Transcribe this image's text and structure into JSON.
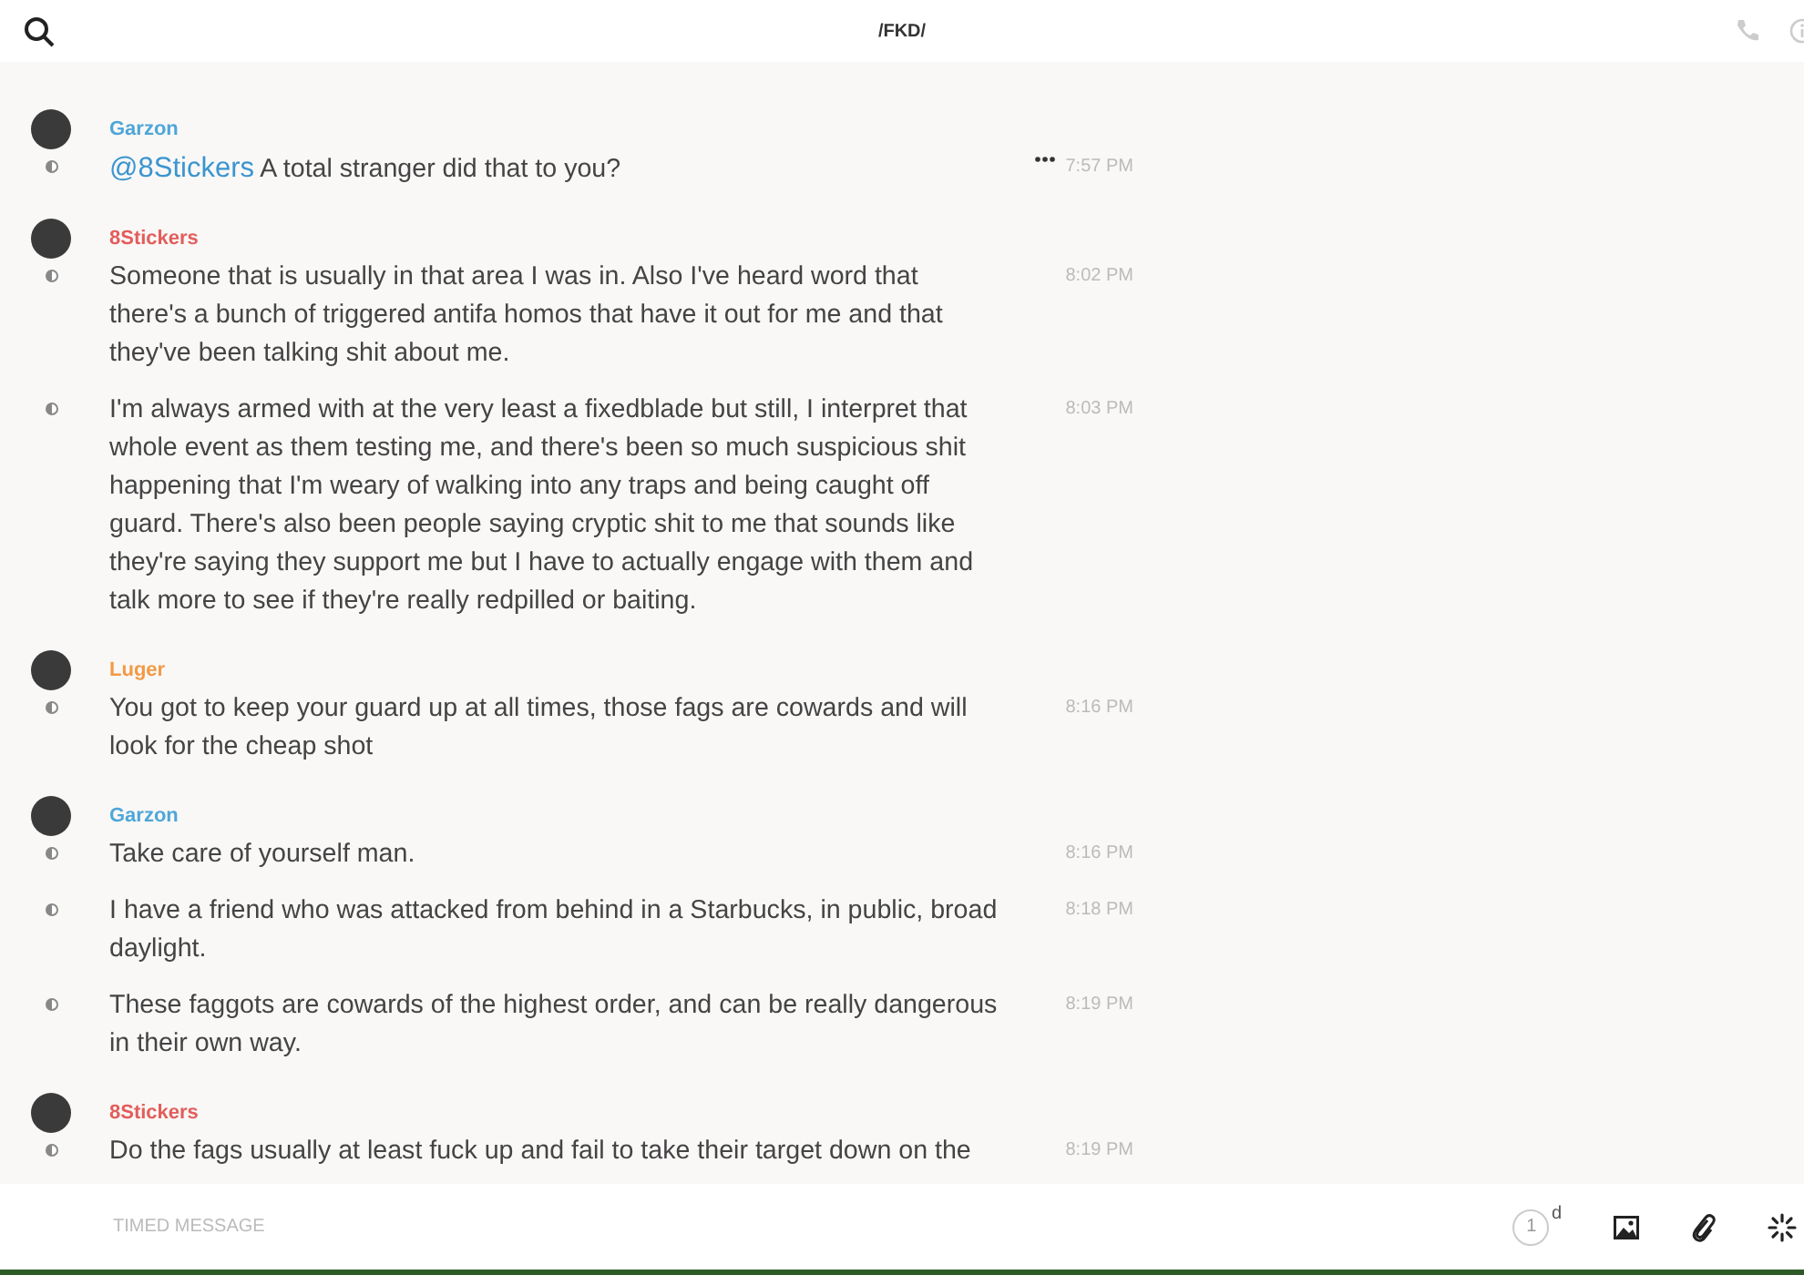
{
  "header": {
    "title": "/FKD/"
  },
  "groups": [
    {
      "author": "Garzon",
      "color": "#4ea6d8",
      "messages": [
        {
          "mention": "@8Stickers",
          "text": "A total stranger did that to you?",
          "time": "7:57 PM",
          "hovered": true
        }
      ]
    },
    {
      "author": "8Stickers",
      "color": "#e35d5b",
      "messages": [
        {
          "text": "Someone that is usually in that area I was in. Also I've heard word that there's a bunch of triggered antifa homos that have it out for me and that they've been talking shit about me.",
          "time": "8:02 PM",
          "hovered": false
        },
        {
          "text": "I'm always armed with at the very least a fixedblade but still, I interpret that whole event as them testing me, and there's been so much suspicious shit happening that I'm weary of walking into any traps and being caught off guard.  There's also been people saying cryptic shit to me that sounds like they're saying they support me but I have to actually engage with them and talk more to see if they're really redpilled or baiting.",
          "time": "8:03 PM",
          "hovered": false
        }
      ]
    },
    {
      "author": "Luger",
      "color": "#f29a45",
      "messages": [
        {
          "text": "You got to keep your guard up at all times, those fags are cowards and will look for the cheap shot",
          "time": "8:16 PM",
          "hovered": false
        }
      ]
    },
    {
      "author": "Garzon",
      "color": "#4ea6d8",
      "messages": [
        {
          "text": "Take care of yourself man.",
          "time": "8:16 PM",
          "hovered": false
        },
        {
          "text": "I have a friend who was attacked from behind in a Starbucks, in public, broad daylight.",
          "time": "8:18 PM",
          "hovered": false
        },
        {
          "text": "These faggots are cowards of the highest order, and can be really dangerous in their own way.",
          "time": "8:19 PM",
          "hovered": false
        }
      ]
    },
    {
      "author": "8Stickers",
      "color": "#e35d5b",
      "messages": [
        {
          "text": "Do the fags usually at least fuck up and fail to take their target down on the",
          "time": "8:19 PM",
          "hovered": false
        }
      ]
    }
  ],
  "composer": {
    "placeholder": "TIMED MESSAGE",
    "timer_value": "1",
    "timer_unit": "d"
  }
}
